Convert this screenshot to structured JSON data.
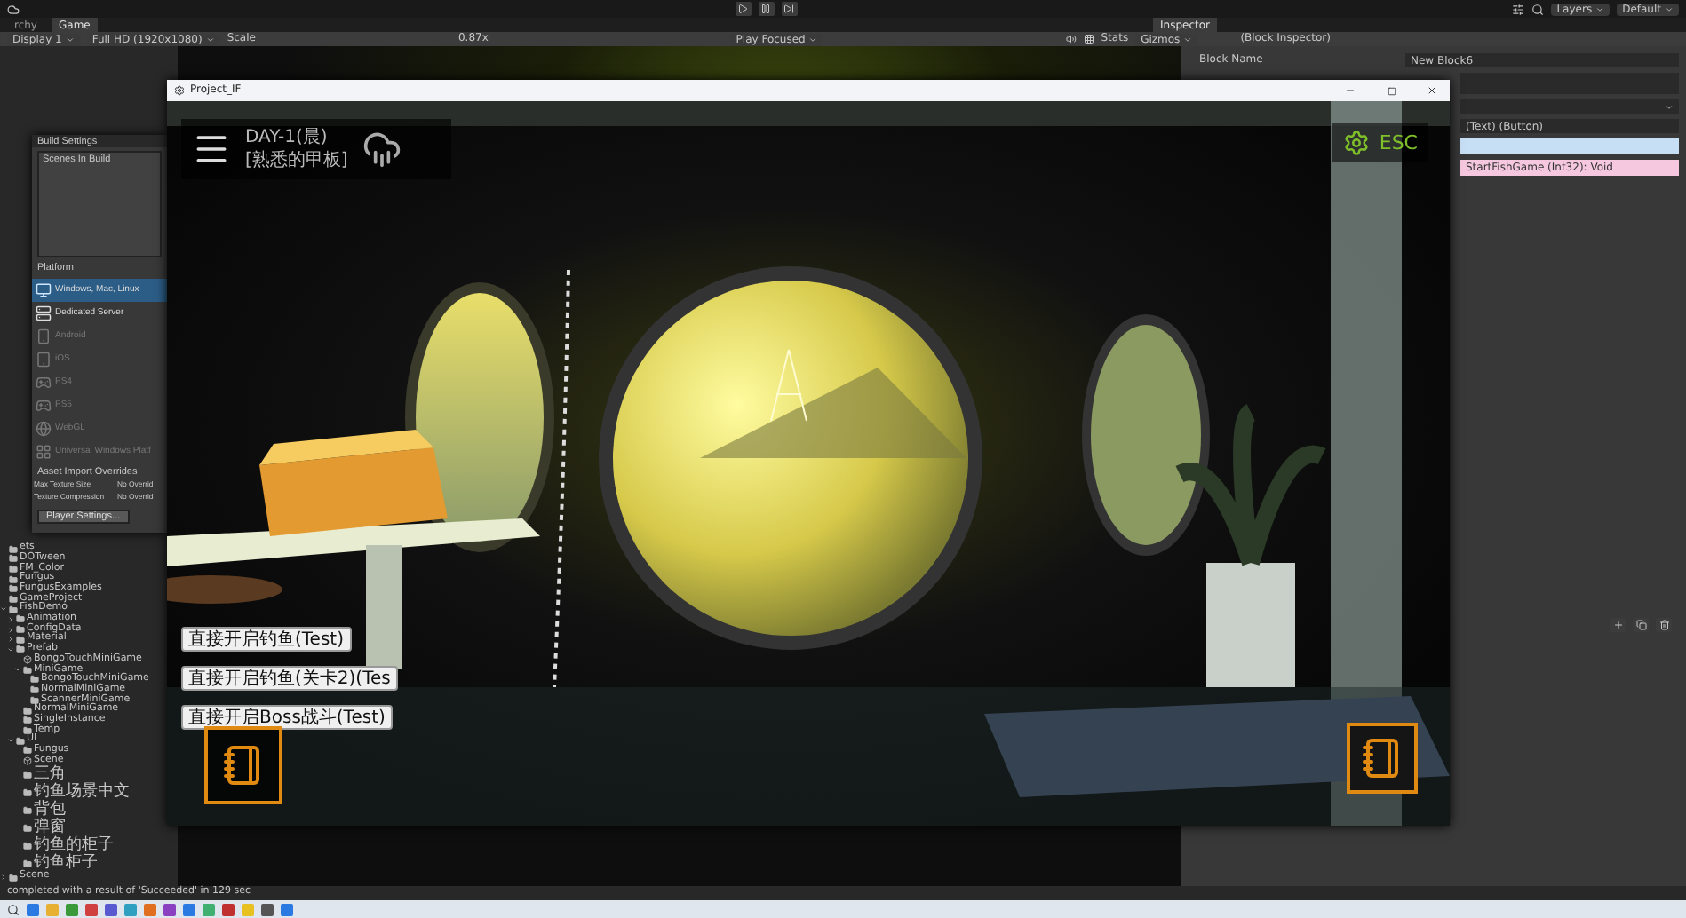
{
  "toolbar": {
    "layers": "Layers",
    "layout": "Default"
  },
  "tabs": [
    {
      "label": "rchy",
      "selected": false
    },
    {
      "label": "Game",
      "selected": true
    }
  ],
  "game_toolbar": {
    "display": "Display 1",
    "resolution": "Full HD (1920x1080)",
    "scale_label": "Scale",
    "scale": "0.87x",
    "play_mode": "Play Focused",
    "stats": "Stats",
    "gizmos": "Gizmos"
  },
  "inspector": {
    "tab": "Inspector",
    "title": "(Block Inspector)",
    "block_name_label": "Block Name",
    "block_name": "New Block6",
    "event_field": "(Text) (Button)",
    "method": "StartFishGame (Int32): Void"
  },
  "build_settings": {
    "title": "Build Settings",
    "scenes_label": "Scenes In Build",
    "platform_label": "Platform",
    "platforms": [
      {
        "label": "Windows, Mac, Linux",
        "kind": "desktop",
        "selected": true,
        "disabled": false
      },
      {
        "label": "Dedicated Server",
        "kind": "server",
        "selected": false,
        "disabled": false
      },
      {
        "label": "Android",
        "kind": "android",
        "selected": false,
        "disabled": true
      },
      {
        "label": "iOS",
        "kind": "ios",
        "selected": false,
        "disabled": true
      },
      {
        "label": "PS4",
        "kind": "console",
        "selected": false,
        "disabled": true
      },
      {
        "label": "PS5",
        "kind": "console",
        "selected": false,
        "disabled": true
      },
      {
        "label": "WebGL",
        "kind": "web",
        "selected": false,
        "disabled": true
      },
      {
        "label": "Universal Windows Platf",
        "kind": "windows",
        "selected": false,
        "disabled": true
      }
    ],
    "overrides_label": "Asset Import Overrides",
    "overrides": [
      {
        "label": "Max Texture Size",
        "value": "No Overrid"
      },
      {
        "label": "Texture Compression",
        "value": "No Overrid"
      }
    ],
    "player_settings": "Player Settings..."
  },
  "project_tree": [
    {
      "label": "ets",
      "kind": "folder"
    },
    {
      "label": "DOTween",
      "kind": "folder"
    },
    {
      "label": "FM_Color",
      "kind": "folder"
    },
    {
      "label": "Fungus",
      "kind": "folder"
    },
    {
      "label": "FungusExamples",
      "kind": "folder"
    },
    {
      "label": "GameProject",
      "kind": "folder"
    },
    {
      "label": "FishDemo",
      "kind": "folder",
      "expanded": true,
      "children": [
        {
          "label": "Animation",
          "kind": "folder",
          "expanded": false
        },
        {
          "label": "ConfigData",
          "kind": "folder",
          "expanded": false
        },
        {
          "label": "Material",
          "kind": "folder",
          "expanded": false
        },
        {
          "label": "Prefab",
          "kind": "folder",
          "expanded": true,
          "children": [
            {
              "label": "BongoTouchMiniGame",
              "kind": "prefab"
            },
            {
              "label": "MiniGame",
              "kind": "folder",
              "expanded": true,
              "children": [
                {
                  "label": "BongoTouchMiniGame",
                  "kind": "folder"
                },
                {
                  "label": "NormalMiniGame",
                  "kind": "folder"
                },
                {
                  "label": "ScannerMiniGame",
                  "kind": "folder"
                }
              ]
            },
            {
              "label": "NormalMiniGame",
              "kind": "folder"
            },
            {
              "label": "SingleInstance",
              "kind": "folder"
            },
            {
              "label": "Temp",
              "kind": "folder"
            }
          ]
        },
        {
          "label": "UI",
          "kind": "folder",
          "expanded": true,
          "children": [
            {
              "label": "Fungus",
              "kind": "folder"
            },
            {
              "label": "Scene",
              "kind": "prefab"
            },
            {
              "label": "三角",
              "kind": "folder"
            },
            {
              "label": "钓鱼场景中文",
              "kind": "folder"
            },
            {
              "label": "背包",
              "kind": "folder"
            },
            {
              "label": "弹窗",
              "kind": "folder"
            },
            {
              "label": "钓鱼的柜子",
              "kind": "folder"
            },
            {
              "label": "钓鱼柜子",
              "kind": "folder"
            }
          ]
        }
      ]
    },
    {
      "label": "Scene",
      "kind": "folder",
      "expanded": false
    }
  ],
  "console_message": "completed with a result of 'Succeeded' in 129 sec",
  "game_window": {
    "title": "Project_IF",
    "hud": {
      "day": "DAY-1(晨)",
      "location": "[熟悉的甲板]",
      "esc": "ESC"
    },
    "debug_buttons": [
      "直接开启钓鱼(Test)",
      "直接开启钓鱼(关卡2)(Tes",
      "直接开启Boss战斗(Test)"
    ]
  }
}
